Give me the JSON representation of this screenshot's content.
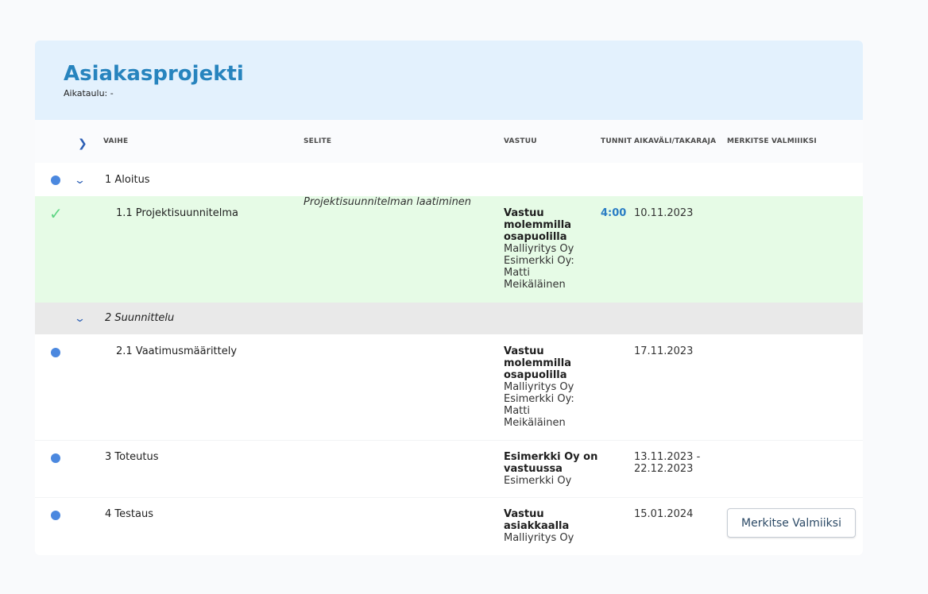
{
  "header": {
    "title": "Asiakasprojekti",
    "schedule": "Aikataulu: -"
  },
  "columns": {
    "phase": "VAIHE",
    "description": "SELITE",
    "responsibility": "VASTUU",
    "hours": "TUNNIT",
    "timeframe": "AIKAVÄLI/TAKARAJA",
    "mark_done": "MERKITSE VALMIIIKSI"
  },
  "icons": {
    "expand_all": "chevron-right-icon",
    "expand": "chevron-down-icon",
    "status_open": "status-dot-icon",
    "status_done": "checkmark-icon"
  },
  "colors": {
    "accent": "#2784be",
    "header_bg": "#e3f1fd",
    "done_row_bg": "#e6fbe6",
    "group_row_bg": "#e9e9e9",
    "status_dot": "#4b88df",
    "checkmark": "#5ed583"
  },
  "rows": {
    "r1": {
      "name": "1 Aloitus"
    },
    "r11": {
      "name": "1.1 Projektisuunnitelma",
      "description": "Projektisuunnitelman laatiminen",
      "resp_bold": [
        "Vastuu",
        "molemmilla",
        "osapuolilla"
      ],
      "resp_lines": [
        "Malliyritys Oy",
        "Esimerkki Oy:",
        "Matti",
        "Meikäläinen"
      ],
      "hours": "4:00",
      "date": "10.11.2023"
    },
    "r2": {
      "name": "2 Suunnittelu"
    },
    "r21": {
      "name": "2.1 Vaatimusmäärittely",
      "resp_bold": [
        "Vastuu",
        "molemmilla",
        "osapuolilla"
      ],
      "resp_lines": [
        "Malliyritys Oy",
        "Esimerkki Oy:",
        "Matti",
        "Meikäläinen"
      ],
      "date": "17.11.2023"
    },
    "r3": {
      "name": "3 Toteutus",
      "resp_bold": [
        "Esimerkki Oy on",
        "vastuussa"
      ],
      "resp_lines": [
        "Esimerkki Oy"
      ],
      "date_lines": [
        "13.11.2023 -",
        "22.12.2023"
      ]
    },
    "r4": {
      "name": "4 Testaus",
      "resp_bold": [
        "Vastuu",
        "asiakkaalla"
      ],
      "resp_lines": [
        "Malliyritys Oy"
      ],
      "date": "15.01.2024",
      "button": "Merkitse Valmiiksi"
    }
  }
}
